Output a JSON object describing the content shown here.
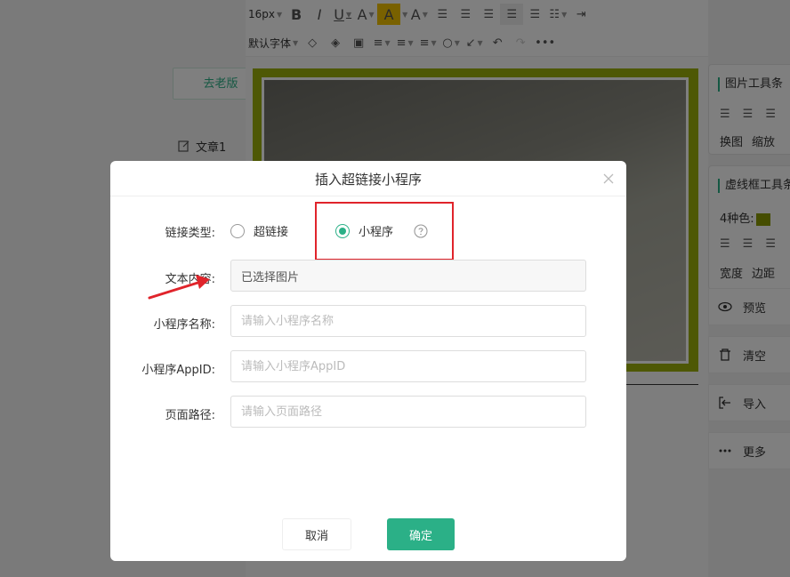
{
  "left": {
    "old_version_button": "去老版",
    "doc_item_label": "文章1"
  },
  "toolbar": {
    "font_size": "16px",
    "default_font": "默认字体"
  },
  "right_panel": {
    "image_toolbar_title": "图片工具条",
    "image_toolbar_actions": [
      "换图",
      "缩放"
    ],
    "dashed_toolbar_title": "虚线框工具条",
    "colors_label": "4种色:",
    "dashed_toolbar_actions": [
      "宽度",
      "边距"
    ],
    "actions": {
      "preview": "预览",
      "clear": "清空",
      "import": "导入",
      "more": "更多"
    }
  },
  "dialog": {
    "title": "插入超链接小程序",
    "link_type_label": "链接类型:",
    "option_hyperlink": "超链接",
    "option_miniprogram": "小程序",
    "selected_option": "小程序",
    "text_content_label": "文本内容:",
    "text_content_value": "已选择图片",
    "miniprogram_name_label": "小程序名称:",
    "miniprogram_name_placeholder": "请输入小程序名称",
    "appid_label": "小程序AppID:",
    "appid_placeholder": "请输入小程序AppID",
    "page_path_label": "页面路径:",
    "page_path_placeholder": "请输入页面路径",
    "cancel_label": "取消",
    "confirm_label": "确定"
  },
  "colors": {
    "accent": "#2bb087",
    "highlight": "#e0242b",
    "image_frame": "#9db10b"
  }
}
